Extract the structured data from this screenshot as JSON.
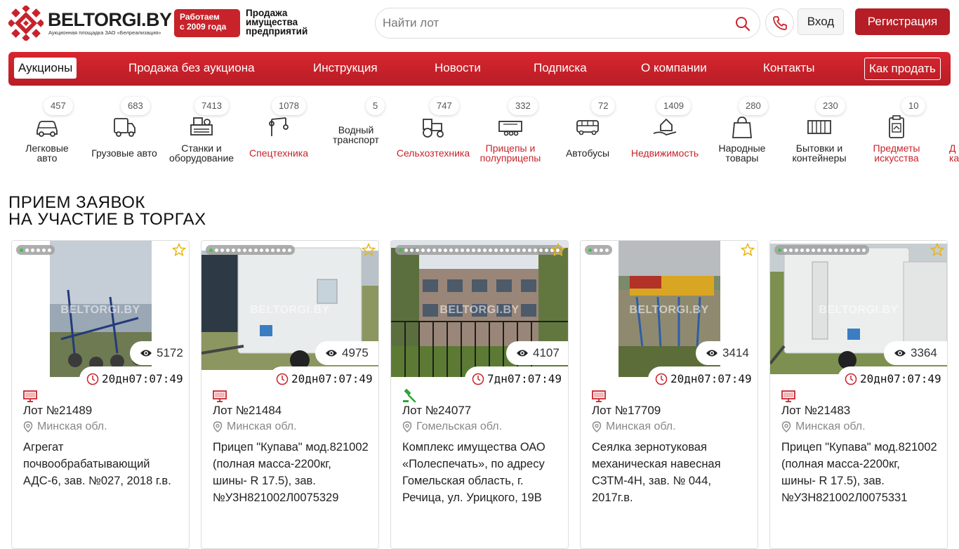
{
  "brand": {
    "name": "BELTORGI.BY",
    "subtitle": "Аукционная площадка ЗАО «Белреализация»",
    "since_line1": "Работаем",
    "since_line2": "с 2009 года",
    "tagline1": "Продажа",
    "tagline2": "имущества",
    "tagline3": "предприятий",
    "accent": "#c8232b"
  },
  "search": {
    "placeholder": "Найти лот"
  },
  "header": {
    "login_label": "Вход",
    "register_label": "Регистрация"
  },
  "nav": {
    "items": [
      {
        "label": "Аукционы"
      },
      {
        "label": "Продажа без аукциона"
      },
      {
        "label": "Инструкция"
      },
      {
        "label": "Новости"
      },
      {
        "label": "Подписка"
      },
      {
        "label": "О компании"
      },
      {
        "label": "Контакты"
      },
      {
        "label": "Как продать"
      }
    ]
  },
  "categories": [
    {
      "count": "457",
      "line1": "Легковые",
      "line2": "авто"
    },
    {
      "count": "683",
      "line1": "Грузовые авто",
      "line2": ""
    },
    {
      "count": "7413",
      "line1": "Станки и",
      "line2": "оборудование"
    },
    {
      "count": "1078",
      "line1": "Спецтехника",
      "line2": ""
    },
    {
      "count": "5",
      "line1": "Водный",
      "line2": "транспорт"
    },
    {
      "count": "747",
      "line1": "Сельхозтехника",
      "line2": ""
    },
    {
      "count": "332",
      "line1": "Прицепы и",
      "line2": "полуприцепы"
    },
    {
      "count": "72",
      "line1": "Автобусы",
      "line2": ""
    },
    {
      "count": "1409",
      "line1": "Недвижимость",
      "line2": ""
    },
    {
      "count": "280",
      "line1": "Народные",
      "line2": "товары"
    },
    {
      "count": "230",
      "line1": "Бытовки и",
      "line2": "контейнеры"
    },
    {
      "count": "10",
      "line1": "Предметы",
      "line2": "искусства"
    },
    {
      "count": "",
      "line1": "Д",
      "line2": "кат"
    }
  ],
  "section": {
    "title_line1": "ПРИЕМ ЗАЯВОК",
    "title_line2": "НА УЧАСТИЕ В ТОРГАХ"
  },
  "watermark": "BELTORGI.BY",
  "lots": [
    {
      "views": "5172",
      "timer": "20дн07:07:49",
      "lot": "Лот №21489",
      "region": "Минская обл.",
      "desc": "Агрегат почвообрабатывающий АДС-6, зав. №027, 2018 г.в.",
      "type_icon": "monitor-icon"
    },
    {
      "views": "4975",
      "timer": "20дн07:07:49",
      "lot": "Лот №21484",
      "region": "Минская обл.",
      "desc": "Прицеп \"Купава\" мод.821002 (полная масса-2200кг, шины- R 17.5), зав. №У3Н821002Л0075329",
      "type_icon": "monitor-icon"
    },
    {
      "views": "4107",
      "timer": "7дн07:07:49",
      "lot": "Лот №24077",
      "region": "Гомельская обл.",
      "desc": "Комплекс имущества ОАО «Полеспечать», по адресу Гомельская область, г. Речица, ул. Урицкого, 19В",
      "type_icon": "gavel-icon"
    },
    {
      "views": "3414",
      "timer": "20дн07:07:49",
      "lot": "Лот №17709",
      "region": "Минская обл.",
      "desc": "Сеялка зернотуковая механическая навесная СЗТМ-4Н, зав. № 044, 2017г.в.",
      "type_icon": "monitor-icon"
    },
    {
      "views": "3364",
      "timer": "20дн07:07:49",
      "lot": "Лот №21483",
      "region": "Минская обл.",
      "desc": "Прицеп \"Купава\" мод.821002 (полная масса-2200кг, шины- R 17.5), зав. №У3Н821002Л0075331",
      "type_icon": "monitor-icon"
    }
  ]
}
